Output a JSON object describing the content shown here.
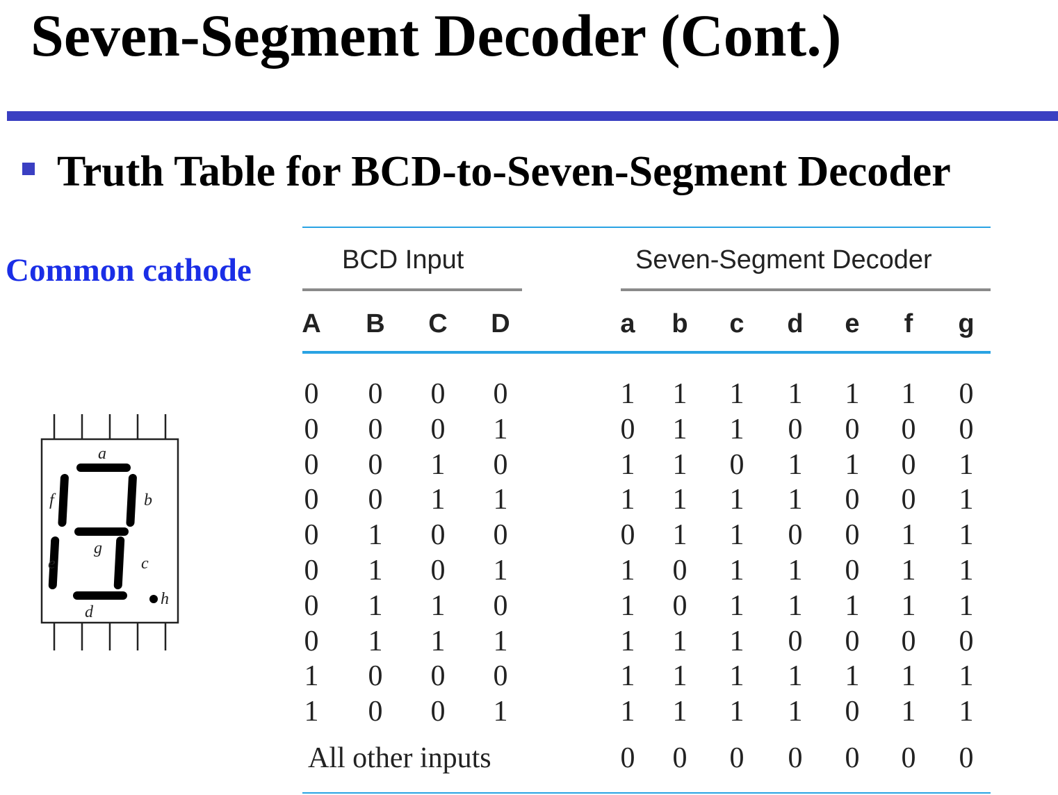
{
  "slide": {
    "title": "Seven-Segment Decoder (Cont.)",
    "bullet": "Truth Table for BCD-to-Seven-Segment Decoder",
    "side_label": "Common cathode"
  },
  "colors": {
    "title_rule": "#3a3fc2",
    "bullet": "#3a3fc2",
    "side_label": "#1a2ee6",
    "table_rule_accent": "#29a3e3",
    "table_rule_gray": "#8a8a8a"
  },
  "segment_display": {
    "labels": [
      "a",
      "b",
      "c",
      "d",
      "e",
      "f",
      "g",
      "h"
    ]
  },
  "truth_table": {
    "group_headers": [
      "BCD Input",
      "Seven-Segment Decoder"
    ],
    "input_columns": [
      "A",
      "B",
      "C",
      "D"
    ],
    "output_columns": [
      "a",
      "b",
      "c",
      "d",
      "e",
      "f",
      "g"
    ],
    "rows": [
      {
        "inputs": [
          "0",
          "0",
          "0",
          "0"
        ],
        "outputs": [
          "1",
          "1",
          "1",
          "1",
          "1",
          "1",
          "0"
        ]
      },
      {
        "inputs": [
          "0",
          "0",
          "0",
          "1"
        ],
        "outputs": [
          "0",
          "1",
          "1",
          "0",
          "0",
          "0",
          "0"
        ]
      },
      {
        "inputs": [
          "0",
          "0",
          "1",
          "0"
        ],
        "outputs": [
          "1",
          "1",
          "0",
          "1",
          "1",
          "0",
          "1"
        ]
      },
      {
        "inputs": [
          "0",
          "0",
          "1",
          "1"
        ],
        "outputs": [
          "1",
          "1",
          "1",
          "1",
          "0",
          "0",
          "1"
        ]
      },
      {
        "inputs": [
          "0",
          "1",
          "0",
          "0"
        ],
        "outputs": [
          "0",
          "1",
          "1",
          "0",
          "0",
          "1",
          "1"
        ]
      },
      {
        "inputs": [
          "0",
          "1",
          "0",
          "1"
        ],
        "outputs": [
          "1",
          "0",
          "1",
          "1",
          "0",
          "1",
          "1"
        ]
      },
      {
        "inputs": [
          "0",
          "1",
          "1",
          "0"
        ],
        "outputs": [
          "1",
          "0",
          "1",
          "1",
          "1",
          "1",
          "1"
        ]
      },
      {
        "inputs": [
          "0",
          "1",
          "1",
          "1"
        ],
        "outputs": [
          "1",
          "1",
          "1",
          "0",
          "0",
          "0",
          "0"
        ]
      },
      {
        "inputs": [
          "1",
          "0",
          "0",
          "0"
        ],
        "outputs": [
          "1",
          "1",
          "1",
          "1",
          "1",
          "1",
          "1"
        ]
      },
      {
        "inputs": [
          "1",
          "0",
          "0",
          "1"
        ],
        "outputs": [
          "1",
          "1",
          "1",
          "1",
          "0",
          "1",
          "1"
        ]
      }
    ],
    "other_row": {
      "label": "All other inputs",
      "outputs": [
        "0",
        "0",
        "0",
        "0",
        "0",
        "0",
        "0"
      ]
    }
  }
}
